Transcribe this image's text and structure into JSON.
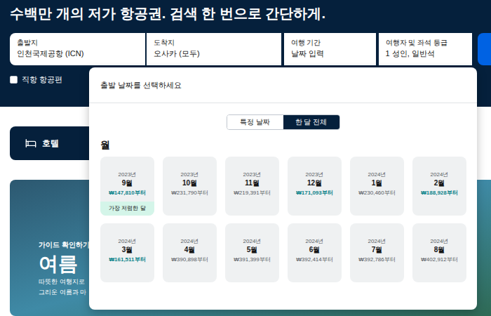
{
  "heading": "수백만 개의 저가 항공권. 검색 한 번으로 간단하게.",
  "search": {
    "fields": [
      {
        "label": "출발지",
        "value": "인천국제공항 (ICN)"
      },
      {
        "label": "도착지",
        "value": "오사카 (모두)"
      },
      {
        "label": "여행 기간",
        "value": "날짜 입력"
      },
      {
        "label": "여행자 및 좌석 등급",
        "value": "1 성인, 일반석"
      }
    ],
    "direct": {
      "label": "직항 항공편",
      "checked": false
    }
  },
  "tabs": [
    {
      "label": "호텔",
      "selected": false
    }
  ],
  "hero": {
    "eyebrow": "가이드 확인하기",
    "title": "여름",
    "lines": [
      "따뜻한 여행지로",
      "그리운 여름과 마"
    ]
  },
  "popup": {
    "title": "출발 날짜를 선택하세요",
    "modes": [
      {
        "label": "특정 날짜",
        "selected": false
      },
      {
        "label": "한 달 전체",
        "selected": true
      }
    ],
    "section": "월",
    "months": [
      {
        "year": "2023년",
        "month": "9월",
        "price": "₩147,810부터",
        "cheap": true,
        "badge": "가장 저렴한 달"
      },
      {
        "year": "2023년",
        "month": "10월",
        "price": "₩231,790부터",
        "cheap": false
      },
      {
        "year": "2023년",
        "month": "11월",
        "price": "₩219,391부터",
        "cheap": false
      },
      {
        "year": "2023년",
        "month": "12월",
        "price": "₩171,093부터",
        "cheap": true
      },
      {
        "year": "2024년",
        "month": "1월",
        "price": "₩230,460부터",
        "cheap": false
      },
      {
        "year": "2024년",
        "month": "2월",
        "price": "₩188,928부터",
        "cheap": true
      },
      {
        "year": "2024년",
        "month": "3월",
        "price": "₩161,511부터",
        "cheap": true
      },
      {
        "year": "2024년",
        "month": "4월",
        "price": "₩390,898부터",
        "cheap": false
      },
      {
        "year": "2024년",
        "month": "5월",
        "price": "₩391,399부터",
        "cheap": false
      },
      {
        "year": "2024년",
        "month": "6월",
        "price": "₩392,414부터",
        "cheap": false
      },
      {
        "year": "2024년",
        "month": "7월",
        "price": "₩392,786부터",
        "cheap": false
      },
      {
        "year": "2024년",
        "month": "8월",
        "price": "₩402,912부터",
        "cheap": false
      }
    ]
  }
}
